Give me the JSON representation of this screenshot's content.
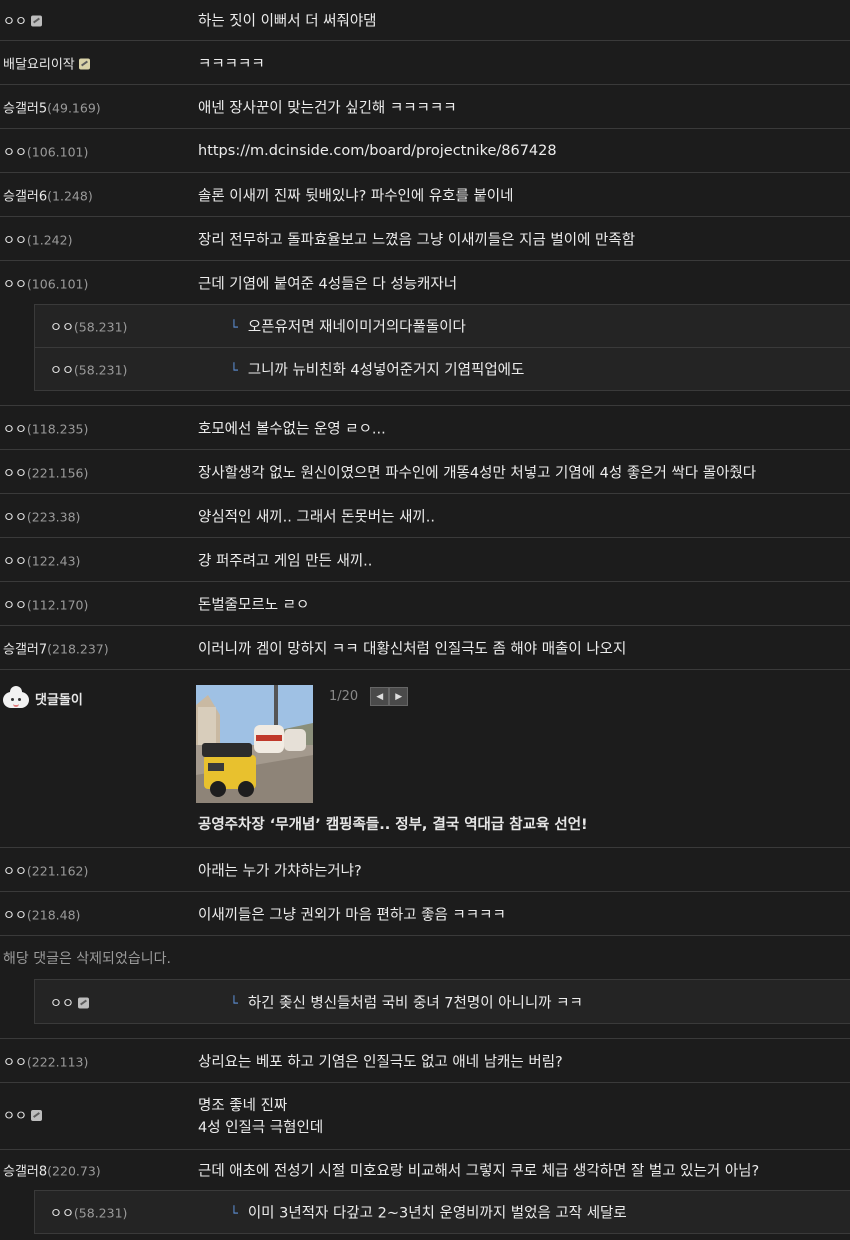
{
  "comments": [
    {
      "nick": "ㅇㅇ",
      "ip": "",
      "icon": true,
      "icon_yellow": false,
      "memo": "하는 짓이 이뻐서 더 써줘야댐"
    },
    {
      "nick": "배달요리이작",
      "ip": "",
      "icon": true,
      "icon_yellow": true,
      "memo": "ㅋㅋㅋㅋㅋ"
    },
    {
      "nick": "승갤러5",
      "ip": "(49.169)",
      "icon": false,
      "memo": "애넨 장사꾼이 맞는건가 싶긴해 ㅋㅋㅋㅋㅋ"
    },
    {
      "nick": "ㅇㅇ",
      "ip": "(106.101)",
      "icon": false,
      "memo": "https://m.dcinside.com/board/projectnike/867428"
    },
    {
      "nick": "승갤러6",
      "ip": "(1.248)",
      "icon": false,
      "memo": "솔론 이새끼 진짜 뒷배있냐? 파수인에 유호를 붙이네"
    },
    {
      "nick": "ㅇㅇ",
      "ip": "(1.242)",
      "icon": false,
      "memo": "장리 전무하고 돌파효율보고 느꼈음 그냥 이새끼들은 지금 벌이에 만족함"
    },
    {
      "nick": "ㅇㅇ",
      "ip": "(106.101)",
      "icon": false,
      "memo": "근데 기염에 붙여준 4성들은 다 성능캐자너"
    }
  ],
  "replies_1": [
    {
      "nick": "ㅇㅇ",
      "ip": "(58.231)",
      "memo": "오픈유저면 재네이미거의다풀돌이다"
    },
    {
      "nick": "ㅇㅇ",
      "ip": "(58.231)",
      "memo": "그니까 뉴비친화 4성넣어준거지 기염픽업에도"
    }
  ],
  "comments_2": [
    {
      "nick": "ㅇㅇ",
      "ip": "(118.235)",
      "memo": "호모에선 볼수없는 운영 ㄹㅇ..."
    },
    {
      "nick": "ㅇㅇ",
      "ip": "(221.156)",
      "memo": "장사할생각 없노 원신이였으면 파수인에 개똥4성만 처넣고 기염에 4성 좋은거 싹다 몰아줬다"
    },
    {
      "nick": "ㅇㅇ",
      "ip": "(223.38)",
      "memo": "양심적인 새끼.. 그래서 돈못버는 새끼.."
    },
    {
      "nick": "ㅇㅇ",
      "ip": "(122.43)",
      "memo": "걍 퍼주려고 게임 만든 새끼.."
    },
    {
      "nick": "ㅇㅇ",
      "ip": "(112.170)",
      "memo": "돈벌줄모르노 ㄹㅇ"
    },
    {
      "nick": "승갤러7",
      "ip": "(218.237)",
      "memo": "이러니까 겜이 망하지 ㅋㅋ 대황신처럼 인질극도 좀 해야 매출이 나오지"
    }
  ],
  "ad": {
    "bot_name": "댓글돌이",
    "page_count": "1/20",
    "prev_label": "◀",
    "next_label": "▶",
    "headline": "공영주차장 ‘무개념’ 캠핑족들.. 정부, 결국 역대급 참교육 선언!"
  },
  "comments_3": [
    {
      "nick": "ㅇㅇ",
      "ip": "(221.162)",
      "memo": "아래는 누가 가챠하는거냐?"
    },
    {
      "nick": "ㅇㅇ",
      "ip": "(218.48)",
      "memo": "이새끼들은 그냥 권외가 마음 편하고 좋음 ㅋㅋㅋㅋ"
    }
  ],
  "deleted_text": "해당 댓글은 삭제되었습니다.",
  "reply_deleted": {
    "nick": "ㅇㅇ",
    "memo": "하긴 좆신 병신들처럼 국비 중녀 7천명이 아니니까 ㅋㅋ"
  },
  "comment_222": {
    "nick": "ㅇㅇ",
    "ip": "(222.113)",
    "memo": "상리요는 베포 하고 기염은 인질극도 없고 애네 남캐는 버림?"
  },
  "comment_multi": {
    "nick": "ㅇㅇ",
    "line1": "명조 좋네 진짜",
    "line2": "4성 인질극 극혐인데"
  },
  "comment_last": {
    "nick": "승갤러8",
    "ip": "(220.73)",
    "memo": "근데 애초에 전성기 시절 미호요랑 비교해서 그렇지 쿠로 체급 생각하면 잘 벌고 있는거 아님?"
  },
  "reply_last": {
    "nick": "ㅇㅇ",
    "ip": "(58.231)",
    "memo": "이미 3년적자 다갚고 2~3년치 운영비까지 벌었음 고작 세달로"
  },
  "colors": {
    "background": "#1c1c1c",
    "divider": "#3a3a3a",
    "reply_bg": "#242424",
    "arrow": "#5d8fd6",
    "ip": "#9a9a9a"
  }
}
